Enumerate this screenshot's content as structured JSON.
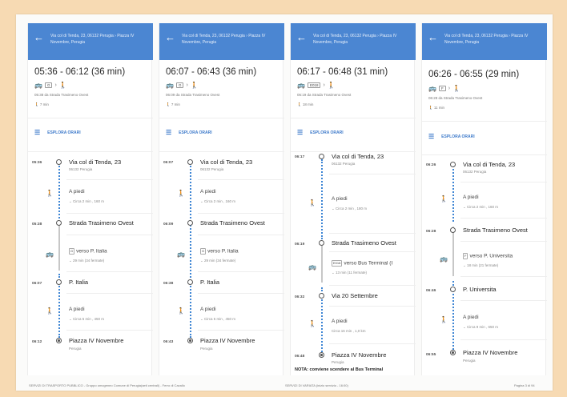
{
  "header_route": "Via col di Tenda, 23, 06132 Perugia › Piazza IV Novembre, Perugia",
  "explore_label": "ESPLORA ORARI",
  "cards": [
    {
      "time_range": "05:36 - 06:12 (36 min)",
      "bus_line": "G",
      "departure": "05:38 da Strada Trasimeno Ovest",
      "walk_total": "7 min",
      "origin": {
        "time": "05:36",
        "name": "Via col di Tenda, 23",
        "sub": "06132 Perugia"
      },
      "walk1": {
        "label": "A piedi",
        "detail": "Circa 2 min , 160 m"
      },
      "stop1": {
        "time": "05:38",
        "name": "Strada Trasimeno Ovest"
      },
      "bus": {
        "label": "verso P. Italia",
        "detail": "29 min (34 fermate)"
      },
      "stop2": {
        "time": "06:07",
        "name": "P. Italia"
      },
      "walk2": {
        "label": "A piedi",
        "detail": "Circa 5 min , 450 m"
      },
      "dest": {
        "time": "06:12",
        "name": "Piazza IV Novembre",
        "sub": "Perugia"
      }
    },
    {
      "time_range": "06:07 - 06:43 (36 min)",
      "bus_line": "G",
      "departure": "06:09 da Strada Trasimeno Ovest",
      "walk_total": "7 min",
      "origin": {
        "time": "06:07",
        "name": "Via col di Tenda, 23",
        "sub": "06132 Perugia"
      },
      "walk1": {
        "label": "A piedi",
        "detail": "Circa 2 min , 160 m"
      },
      "stop1": {
        "time": "06:09",
        "name": "Strada Trasimeno Ovest"
      },
      "bus": {
        "label": "verso P. Italia",
        "detail": "29 min (34 fermate)"
      },
      "stop2": {
        "time": "06:38",
        "name": "P. Italia"
      },
      "walk2": {
        "label": "A piedi",
        "detail": "Circa 5 min , 450 m"
      },
      "dest": {
        "time": "06:43",
        "name": "Piazza IV Novembre",
        "sub": "Perugia"
      }
    },
    {
      "time_range": "06:17 - 06:48 (31 min)",
      "bus_line": "E018",
      "departure": "06:19 da Strada Trasimeno Ovest",
      "walk_total": "18 min",
      "origin": {
        "time": "06:17",
        "name": "Via col di Tenda, 23",
        "sub": "06132 Perugia"
      },
      "walk1": {
        "label": "A piedi",
        "detail": "Circa 2 min , 180 m"
      },
      "stop1": {
        "time": "06:19",
        "name": "Strada Trasimeno Ovest"
      },
      "bus": {
        "label": "verso Bus Terminal (I",
        "detail": "13 min (11 fermate)"
      },
      "stop2": {
        "time": "06:32",
        "name": "Via 20 Settembre"
      },
      "walk2": {
        "label": "A piedi",
        "detail": "Circa 16 min , 1,0 km"
      },
      "dest": {
        "time": "06:48",
        "name": "Piazza IV Novembre",
        "sub": "Perugia"
      },
      "note": "NOTA: conviene scendere al Bus Terminal"
    },
    {
      "time_range": "06:26 - 06:55 (29 min)",
      "bus_line": "F",
      "departure": "06:28 da Strada Trasimeno Ovest",
      "walk_total": "11 min",
      "origin": {
        "time": "06:26",
        "name": "Via col di Tenda, 23",
        "sub": "06132 Perugia"
      },
      "walk1": {
        "label": "A piedi",
        "detail": "Circa 2 min , 160 m"
      },
      "stop1": {
        "time": "06:28",
        "name": "Strada Trasimeno Ovest"
      },
      "bus": {
        "label": "verso P. Universita",
        "detail": "18 min (21 fermate)"
      },
      "stop2": {
        "time": "06:46",
        "name": "P. Universita"
      },
      "walk2": {
        "label": "A piedi",
        "detail": "Circa 9 min , 650 m"
      },
      "dest": {
        "time": "06:55",
        "name": "Piazza IV Novembre",
        "sub": "Perugia"
      }
    }
  ],
  "footer": {
    "left": "SERVIZI DI TRASPORTO PUBBLICO - Gruppo omogeneo Comune di Perugia(aeti centrali) - Ferro di Cavallo",
    "middle": "SERVIZI DI VARIATA (inizio servizio - 16:00)",
    "right": "Pagina 3 di 94"
  },
  "colors": {
    "accent": "#4b86d2",
    "route_dots": "#3f86d4",
    "page_bg": "#f7dab3"
  }
}
